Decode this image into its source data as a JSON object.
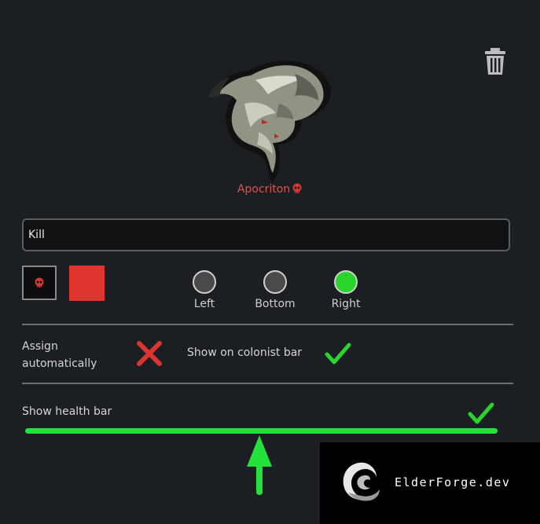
{
  "pawn": {
    "name": "Apocriton"
  },
  "label": {
    "value": "Kill"
  },
  "colors": {
    "accent": "#e0342f",
    "name": "#d9534f",
    "check": "#2bd42b",
    "cross": "#d9362f"
  },
  "positions": {
    "options": [
      {
        "label": "Left",
        "selected": false
      },
      {
        "label": "Bottom",
        "selected": false
      },
      {
        "label": "Right",
        "selected": true
      }
    ]
  },
  "settings": {
    "assign_label": "Assign\nautomatically",
    "assign_value": "off",
    "colonist_bar_label": "Show on colonist bar",
    "colonist_bar_value": "on",
    "health_bar_label": "Show health bar",
    "health_bar_value": "on"
  },
  "icons": {
    "delete": "trash-icon",
    "label_icon": "skull-icon",
    "checked": "checkmark-icon",
    "unchecked": "cross-icon"
  },
  "watermark": {
    "text": "ElderForge.dev"
  }
}
